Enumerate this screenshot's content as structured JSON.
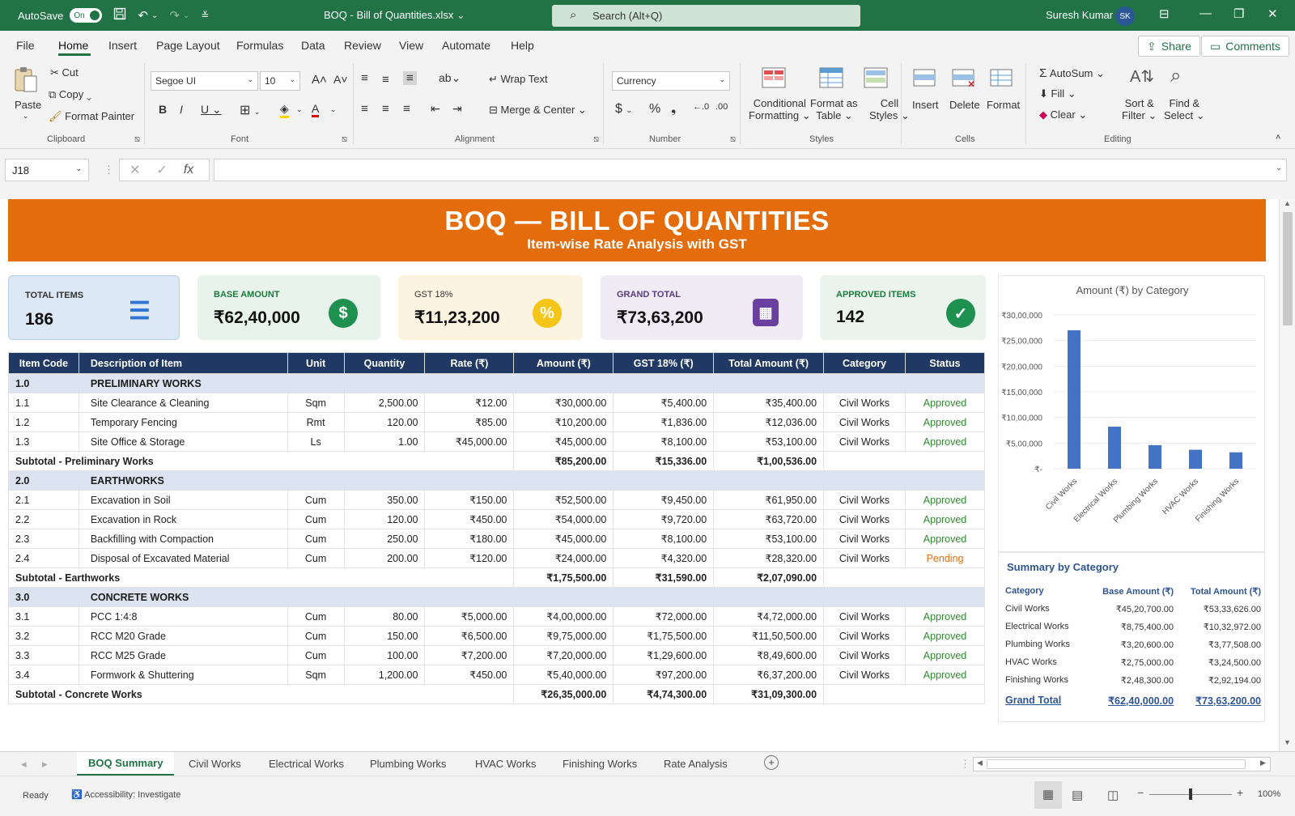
{
  "titlebar": {
    "autosave_label": "AutoSave",
    "autosave_state": "On",
    "doc_title": "BOQ - Bill of Quantities.xlsx",
    "search_placeholder": "Search (Alt+Q)",
    "user_name": "Suresh Kumar",
    "user_initials": "SK"
  },
  "menu": {
    "items": [
      "File",
      "Home",
      "Insert",
      "Page Layout",
      "Formulas",
      "Data",
      "Review",
      "View",
      "Automate",
      "Help"
    ],
    "share": "Share",
    "comments": "Comments"
  },
  "ribbon": {
    "clipboard": {
      "paste": "Paste",
      "cut": "Cut",
      "copy": "Copy",
      "format_painter": "Format Painter",
      "group": "Clipboard"
    },
    "font": {
      "name": "Segoe UI",
      "size": "10",
      "group": "Font"
    },
    "alignment": {
      "wrap_text": "Wrap Text",
      "merge_center": "Merge & Center",
      "group": "Alignment"
    },
    "number": {
      "format": "Currency",
      "group": "Number"
    },
    "styles": {
      "conditional_1": "Conditional",
      "conditional_2": "Formatting",
      "format_as_1": "Format as",
      "format_as_2": "Table",
      "cell_1": "Cell",
      "cell_2": "Styles",
      "group": "Styles"
    },
    "cells": {
      "insert": "Insert",
      "delete": "Delete",
      "format": "Format",
      "group": "Cells"
    },
    "editing": {
      "autosum": "AutoSum",
      "fill": "Fill",
      "clear": "Clear",
      "sort_1": "Sort &",
      "sort_2": "Filter",
      "find_1": "Find &",
      "find_2": "Select",
      "group": "Editing"
    }
  },
  "formula_bar": {
    "name_box": "J18",
    "formula": ""
  },
  "banner": {
    "title": "BOQ — BILL OF QUANTITIES",
    "subtitle": "Item-wise Rate Analysis with GST"
  },
  "cards": {
    "total_items": {
      "label": "TOTAL ITEMS",
      "value": "186"
    },
    "base_amount": {
      "label": "BASE AMOUNT",
      "value": "₹62,40,000"
    },
    "gst": {
      "label": "GST 18%",
      "value": "₹11,23,200"
    },
    "grand_total": {
      "label": "GRAND TOTAL",
      "value": "₹73,63,200"
    },
    "approved": {
      "label": "APPROVED ITEMS",
      "value": "142"
    }
  },
  "table": {
    "headers": [
      "Item Code",
      "Description of Item",
      "Unit",
      "Quantity",
      "Rate (₹)",
      "Amount (₹)",
      "GST 18% (₹)",
      "Total Amount (₹)",
      "Category",
      "Status"
    ],
    "rows": [
      {
        "type": "sec",
        "code": "1.0",
        "desc": "PRELIMINARY WORKS"
      },
      {
        "type": "item",
        "code": "1.1",
        "desc": "Site Clearance & Cleaning",
        "unit": "Sqm",
        "qty": "2,500.00",
        "rate": "₹12.00",
        "amount": "₹30,000.00",
        "gst": "₹5,400.00",
        "total": "₹35,400.00",
        "cat": "Civil Works",
        "status": "Approved"
      },
      {
        "type": "item",
        "code": "1.2",
        "desc": "Temporary Fencing",
        "unit": "Rmt",
        "qty": "120.00",
        "rate": "₹85.00",
        "amount": "₹10,200.00",
        "gst": "₹1,836.00",
        "total": "₹12,036.00",
        "cat": "Civil Works",
        "status": "Approved"
      },
      {
        "type": "item",
        "code": "1.3",
        "desc": "Site Office & Storage",
        "unit": "Ls",
        "qty": "1.00",
        "rate": "₹45,000.00",
        "amount": "₹45,000.00",
        "gst": "₹8,100.00",
        "total": "₹53,100.00",
        "cat": "Civil Works",
        "status": "Approved"
      },
      {
        "type": "sub",
        "label": "Subtotal - Preliminary Works",
        "amount": "₹85,200.00",
        "gst": "₹15,336.00",
        "total": "₹1,00,536.00"
      },
      {
        "type": "sec",
        "code": "2.0",
        "desc": "EARTHWORKS"
      },
      {
        "type": "item",
        "code": "2.1",
        "desc": "Excavation in Soil",
        "unit": "Cum",
        "qty": "350.00",
        "rate": "₹150.00",
        "amount": "₹52,500.00",
        "gst": "₹9,450.00",
        "total": "₹61,950.00",
        "cat": "Civil Works",
        "status": "Approved"
      },
      {
        "type": "item",
        "code": "2.2",
        "desc": "Excavation in Rock",
        "unit": "Cum",
        "qty": "120.00",
        "rate": "₹450.00",
        "amount": "₹54,000.00",
        "gst": "₹9,720.00",
        "total": "₹63,720.00",
        "cat": "Civil Works",
        "status": "Approved"
      },
      {
        "type": "item",
        "code": "2.3",
        "desc": "Backfilling with Compaction",
        "unit": "Cum",
        "qty": "250.00",
        "rate": "₹180.00",
        "amount": "₹45,000.00",
        "gst": "₹8,100.00",
        "total": "₹53,100.00",
        "cat": "Civil Works",
        "status": "Approved"
      },
      {
        "type": "item",
        "code": "2.4",
        "desc": "Disposal of Excavated Material",
        "unit": "Cum",
        "qty": "200.00",
        "rate": "₹120.00",
        "amount": "₹24,000.00",
        "gst": "₹4,320.00",
        "total": "₹28,320.00",
        "cat": "Civil Works",
        "status": "Pending"
      },
      {
        "type": "sub",
        "label": "Subtotal - Earthworks",
        "amount": "₹1,75,500.00",
        "gst": "₹31,590.00",
        "total": "₹2,07,090.00"
      },
      {
        "type": "sec",
        "code": "3.0",
        "desc": "CONCRETE WORKS"
      },
      {
        "type": "item",
        "code": "3.1",
        "desc": "PCC 1:4:8",
        "unit": "Cum",
        "qty": "80.00",
        "rate": "₹5,000.00",
        "amount": "₹4,00,000.00",
        "gst": "₹72,000.00",
        "total": "₹4,72,000.00",
        "cat": "Civil Works",
        "status": "Approved"
      },
      {
        "type": "item",
        "code": "3.2",
        "desc": "RCC M20 Grade",
        "unit": "Cum",
        "qty": "150.00",
        "rate": "₹6,500.00",
        "amount": "₹9,75,000.00",
        "gst": "₹1,75,500.00",
        "total": "₹11,50,500.00",
        "cat": "Civil Works",
        "status": "Approved"
      },
      {
        "type": "item",
        "code": "3.3",
        "desc": "RCC M25 Grade",
        "unit": "Cum",
        "qty": "100.00",
        "rate": "₹7,200.00",
        "amount": "₹7,20,000.00",
        "gst": "₹1,29,600.00",
        "total": "₹8,49,600.00",
        "cat": "Civil Works",
        "status": "Approved"
      },
      {
        "type": "item",
        "code": "3.4",
        "desc": "Formwork & Shuttering",
        "unit": "Sqm",
        "qty": "1,200.00",
        "rate": "₹450.00",
        "amount": "₹5,40,000.00",
        "gst": "₹97,200.00",
        "total": "₹6,37,200.00",
        "cat": "Civil Works",
        "status": "Approved"
      },
      {
        "type": "sub",
        "label": "Subtotal - Concrete Works",
        "amount": "₹26,35,000.00",
        "gst": "₹4,74,300.00",
        "total": "₹31,09,300.00"
      }
    ]
  },
  "chart_data": {
    "type": "bar",
    "title": "Amount (₹) by Category",
    "categories": [
      "Civil Works",
      "Electrical Works",
      "Plumbing Works",
      "HVAC Works",
      "Finishing Works"
    ],
    "values": [
      2700000,
      820000,
      460000,
      370000,
      320000
    ],
    "ylim": [
      0,
      3000000
    ],
    "yticks": [
      "₹30,00,000",
      "₹25,00,000",
      "₹20,00,000",
      "₹15,00,000",
      "₹10,00,000",
      "₹5,00,000",
      "₹-"
    ],
    "grid": true,
    "color": "#4472c4"
  },
  "summary": {
    "title": "Summary by Category",
    "headers": [
      "Category",
      "Base Amount (₹)",
      "Total Amount (₹)"
    ],
    "rows": [
      [
        "Civil Works",
        "₹45,20,700.00",
        "₹53,33,626.00"
      ],
      [
        "Electrical Works",
        "₹8,75,400.00",
        "₹10,32,972.00"
      ],
      [
        "Plumbing Works",
        "₹3,20,600.00",
        "₹3,77,508.00"
      ],
      [
        "HVAC Works",
        "₹2,75,000.00",
        "₹3,24,500.00"
      ],
      [
        "Finishing Works",
        "₹2,48,300.00",
        "₹2,92,194.00"
      ]
    ],
    "grand_total": [
      "Grand Total",
      "₹62,40,000.00",
      "₹73,63,200.00"
    ]
  },
  "tabs": [
    "BOQ Summary",
    "Civil Works",
    "Electrical Works",
    "Plumbing Works",
    "HVAC Works",
    "Finishing Works",
    "Rate Analysis"
  ],
  "status": {
    "ready": "Ready",
    "accessibility": "Accessibility: Investigate",
    "zoom": "100%"
  },
  "colors": {
    "excel_green": "#217346",
    "banner": "#e46c0a",
    "header_navy": "#1f3864",
    "section": "#dbe4f0"
  }
}
